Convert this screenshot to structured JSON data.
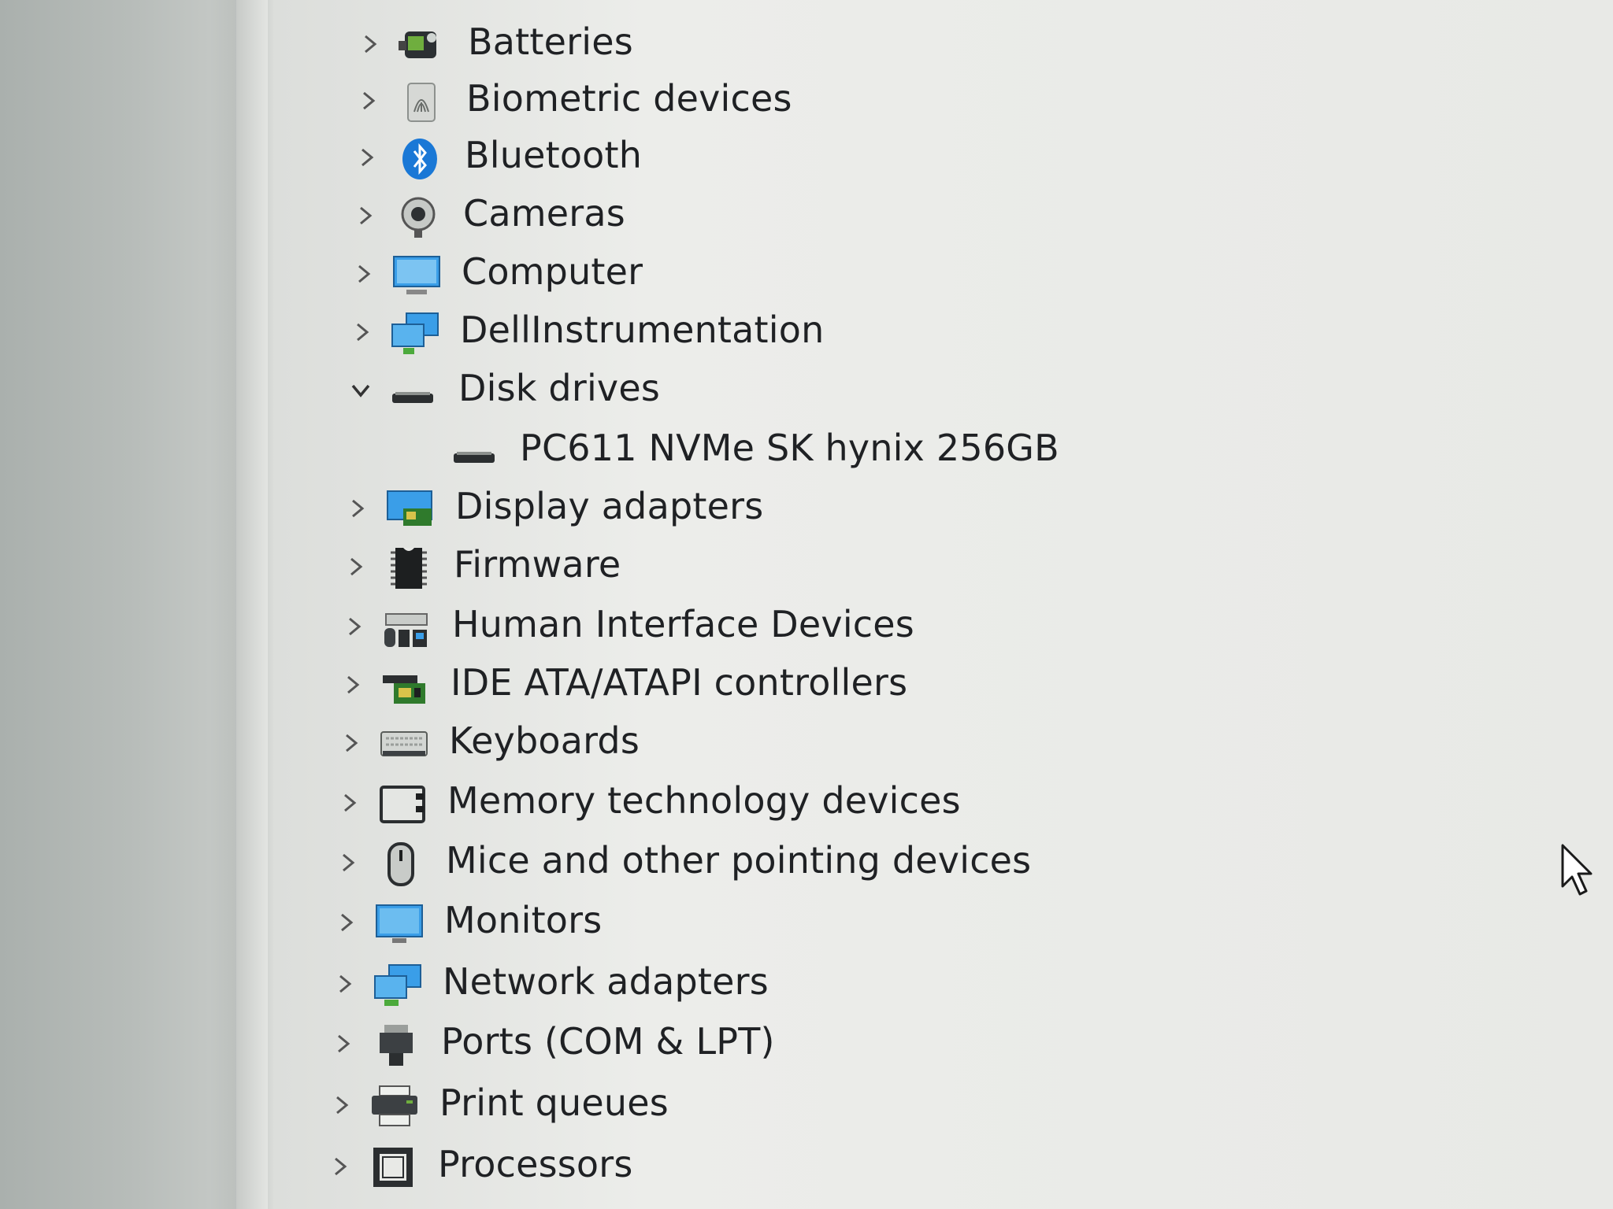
{
  "tree": {
    "items": [
      {
        "label": "Batteries",
        "icon": "battery-icon",
        "expanded": false
      },
      {
        "label": "Biometric devices",
        "icon": "fingerprint-icon",
        "expanded": false
      },
      {
        "label": "Bluetooth",
        "icon": "bluetooth-icon",
        "expanded": false
      },
      {
        "label": "Cameras",
        "icon": "camera-icon",
        "expanded": false
      },
      {
        "label": "Computer",
        "icon": "computer-icon",
        "expanded": false
      },
      {
        "label": "DellInstrumentation",
        "icon": "network-computer-icon",
        "expanded": false
      },
      {
        "label": "Disk drives",
        "icon": "disk-drive-icon",
        "expanded": true
      },
      {
        "label": "PC611 NVMe SK hynix 256GB",
        "icon": "disk-drive-icon",
        "child": true
      },
      {
        "label": "Display adapters",
        "icon": "display-adapter-icon",
        "expanded": false
      },
      {
        "label": "Firmware",
        "icon": "chip-icon",
        "expanded": false
      },
      {
        "label": "Human Interface Devices",
        "icon": "hid-icon",
        "expanded": false
      },
      {
        "label": "IDE ATA/ATAPI controllers",
        "icon": "ide-controller-icon",
        "expanded": false
      },
      {
        "label": "Keyboards",
        "icon": "keyboard-icon",
        "expanded": false
      },
      {
        "label": "Memory technology devices",
        "icon": "memory-card-icon",
        "expanded": false
      },
      {
        "label": "Mice and other pointing devices",
        "icon": "mouse-icon",
        "expanded": false
      },
      {
        "label": "Monitors",
        "icon": "monitor-icon",
        "expanded": false
      },
      {
        "label": "Network adapters",
        "icon": "network-adapter-icon",
        "expanded": false
      },
      {
        "label": "Ports (COM & LPT)",
        "icon": "port-icon",
        "expanded": false
      },
      {
        "label": "Print queues",
        "icon": "printer-icon",
        "expanded": false
      },
      {
        "label": "Processors",
        "icon": "processor-icon",
        "expanded": false
      }
    ]
  }
}
